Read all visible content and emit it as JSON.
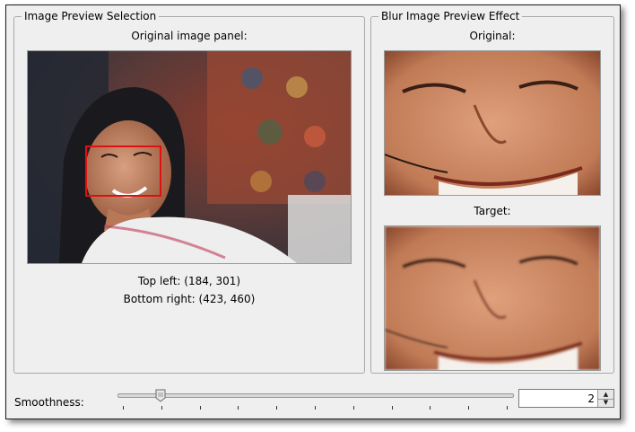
{
  "left_panel": {
    "title": "Image Preview Selection",
    "caption": "Original image panel:",
    "top_left_text": "Top left: (184, 301)",
    "bottom_right_text": "Bottom right: (423, 460)"
  },
  "right_panel": {
    "title": "Blur Image Preview Effect",
    "original_label": "Original:",
    "target_label": "Target:"
  },
  "smoothness": {
    "label": "Smoothness:",
    "value": "2",
    "slider_fraction": 0.11,
    "tick_count": 11
  },
  "colors": {
    "selection": "#e01010",
    "window_bg": "#efefef"
  },
  "icons": {
    "spin_up": "chevron-up-icon",
    "spin_down": "chevron-down-icon",
    "slider_handle": "slider-handle-icon"
  }
}
